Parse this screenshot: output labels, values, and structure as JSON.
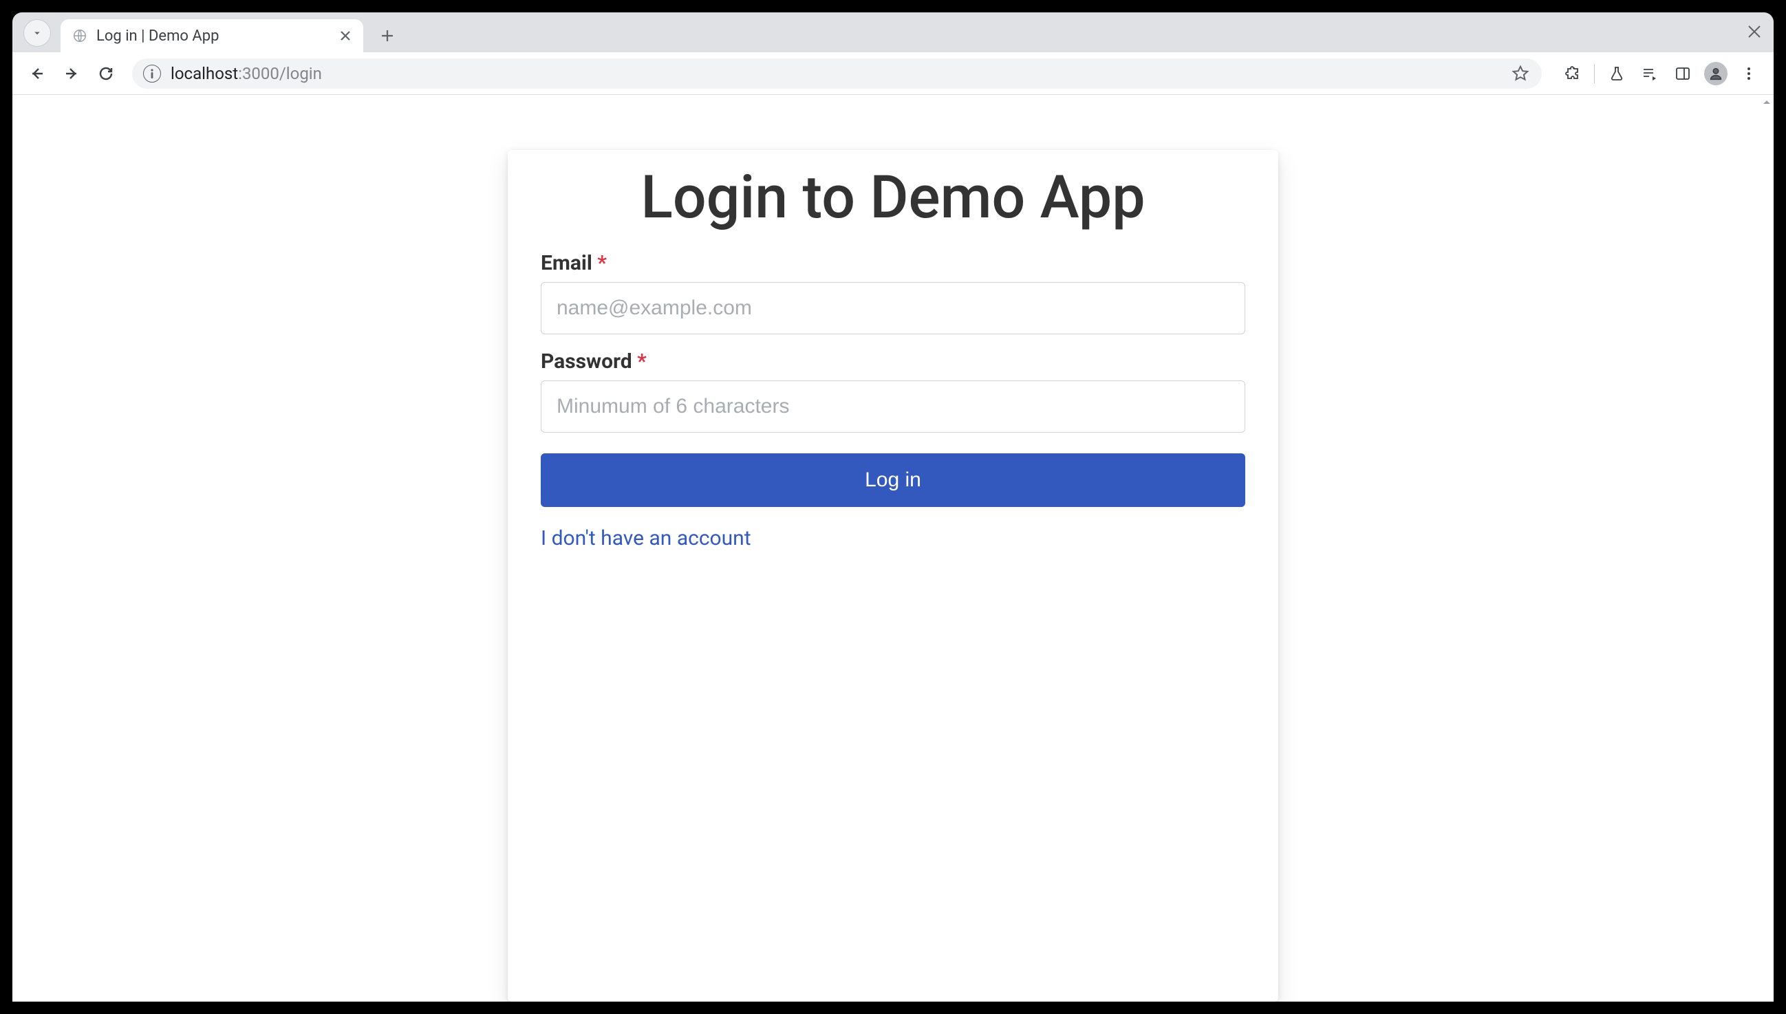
{
  "browser": {
    "tab_title": "Log in | Demo App",
    "url_host": "localhost",
    "url_rest": ":3000/login"
  },
  "login": {
    "heading": "Login to Demo App",
    "email_label": "Email",
    "email_placeholder": "name@example.com",
    "password_label": "Password",
    "password_placeholder": "Minumum of 6 characters",
    "required_mark": "*",
    "submit_label": "Log in",
    "signup_link": "I don't have an account"
  }
}
